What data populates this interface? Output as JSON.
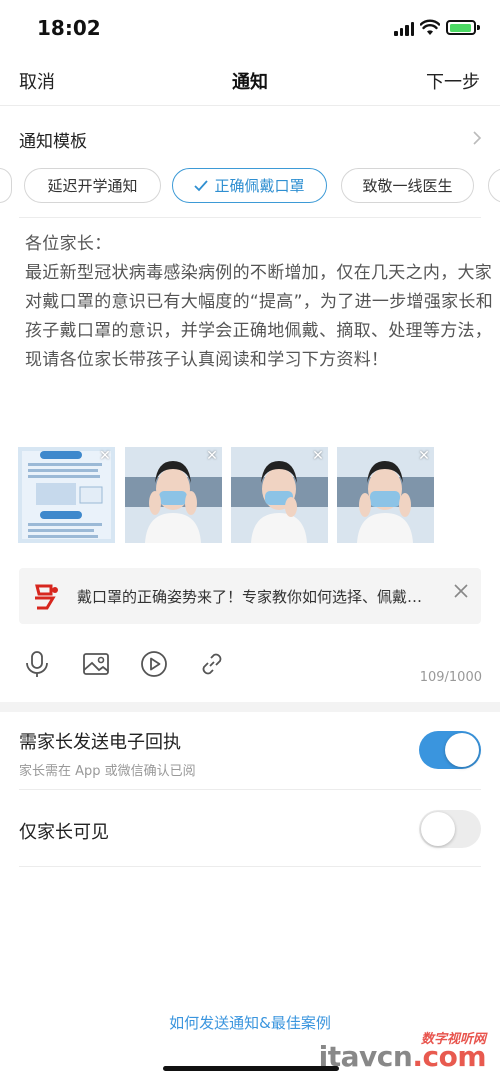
{
  "status_bar": {
    "time": "18:02"
  },
  "nav": {
    "cancel": "取消",
    "title": "通知",
    "next": "下一步"
  },
  "template": {
    "label": "通知模板",
    "chips": [
      {
        "label": "延迟开学通知",
        "selected": false
      },
      {
        "label": "正确佩戴口罩",
        "selected": true
      },
      {
        "label": "致敬一线医生",
        "selected": false
      }
    ]
  },
  "message": {
    "greeting": "各位家长：",
    "body": "最近新型冠状病毒感染病例的不断增加，仅在几天之内，大家对戴口罩的意识已有大幅度的“提高”，为了进一步增强家长和孩子戴口罩的意识，并学会正确地佩戴、摘取、处理等方法，现请各位家长带孩子认真阅读和学习下方资料！"
  },
  "attachment": {
    "title": "戴口罩的正确姿势来了！专家教你如何选择、佩戴…"
  },
  "editor": {
    "char_count": "109/1000"
  },
  "settings": {
    "receipt": {
      "title": "需家长发送电子回执",
      "subtitle": "家长需在 App 或微信确认已阅",
      "enabled": true
    },
    "parents_only": {
      "title": "仅家长可见",
      "enabled": false
    }
  },
  "footer": {
    "help_link": "如何发送通知&最佳案例"
  },
  "watermark": {
    "top": "数字视听网",
    "brand": "itavcn",
    "domain": ".com"
  },
  "colors": {
    "accent": "#3a95de",
    "toggle_off": "#ececec",
    "battery": "#4cd964"
  },
  "icons": [
    "microphone-icon",
    "image-icon",
    "video-play-icon",
    "link-icon",
    "close-icon",
    "chevron-right-icon",
    "checkmark-icon"
  ]
}
